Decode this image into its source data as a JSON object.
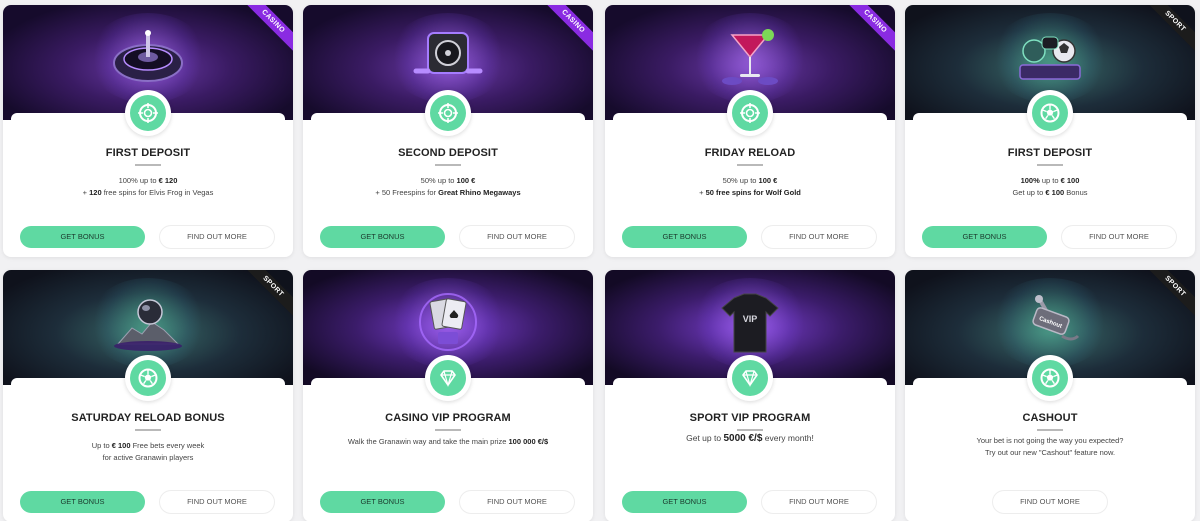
{
  "cards": [
    {
      "tag": "Casino",
      "title": "FIRST DEPOSIT",
      "line1_a": "100%",
      "line1_b": " up to ",
      "line1_c": "€ 120",
      "line2_a": "+ ",
      "line2_b": "120",
      "line2_c": " free spins for Elvis Frog in Vegas",
      "bonus_label": "GET BONUS",
      "more_label": "FIND OUT MORE",
      "icon": "roulette-chip-icon"
    },
    {
      "tag": "Casino",
      "title": "SECOND DEPOSIT",
      "line1_a": "50%",
      "line1_b": " up to ",
      "line1_c": "100 €",
      "line2_a": "+ 50 Freespins for ",
      "line2_b": "Great Rhino Megaways",
      "line2_c": "",
      "bonus_label": "GET BONUS",
      "more_label": "FIND OUT MORE",
      "icon": "roulette-chip-icon"
    },
    {
      "tag": "Casino",
      "title": "FRIDAY RELOAD",
      "line1_a": "50%",
      "line1_b": " up to ",
      "line1_c": "100 €",
      "line2_a": "+ ",
      "line2_b": "50 free spins for Wolf Gold",
      "line2_c": "",
      "bonus_label": "GET BONUS",
      "more_label": "FIND OUT MORE",
      "icon": "roulette-chip-icon"
    },
    {
      "tag": "Sport",
      "title": "FIRST DEPOSIT",
      "line1_a": "100%",
      "line1_b": " up to ",
      "line1_c": "€ 100",
      "line2_a": "Get up to ",
      "line2_b": "€ 100",
      "line2_c": " Bonus",
      "bonus_label": "GET BONUS",
      "more_label": "FIND OUT MORE",
      "icon": "soccer-ball-icon"
    },
    {
      "tag": "Sport",
      "title": "SATURDAY RELOAD BONUS",
      "line1_a": "Up to ",
      "line1_b": "€ 100",
      "line1_c": " Free bets every week",
      "line2_a": "for active Granawin players",
      "line2_b": "",
      "line2_c": "",
      "bonus_label": "GET BONUS",
      "more_label": "FIND OUT MORE",
      "icon": "soccer-ball-icon"
    },
    {
      "tag": "",
      "title": "CASINO VIP PROGRAM",
      "line1_a": "Walk the Granawin way and take the main prize ",
      "line1_b": "100 000 €/$",
      "line1_c": "",
      "line2_a": "",
      "line2_b": "",
      "line2_c": "",
      "bonus_label": "GET BONUS",
      "more_label": "FIND OUT MORE",
      "icon": "diamond-icon"
    },
    {
      "tag": "",
      "title": "SPORT VIP PROGRAM",
      "line1_a": "Get up to ",
      "line1_b": "5000 €/$",
      "line1_c": " every month!",
      "line2_a": "",
      "line2_b": "",
      "line2_c": "",
      "bonus_label": "GET BONUS",
      "more_label": "FIND OUT MORE",
      "icon": "diamond-icon"
    },
    {
      "tag": "Sport",
      "title": "CASHOUT",
      "line1_a": "Your bet is not going the way you expected?",
      "line1_b": "",
      "line1_c": "",
      "line2_a": "Try out our new \"Cashout\" feature now.",
      "line2_b": "",
      "line2_c": "",
      "bonus_label": "",
      "more_label": "FIND OUT MORE",
      "icon": "soccer-ball-icon"
    }
  ],
  "colors": {
    "accent": "#5fd9a2",
    "casino_ribbon": "#8a2be2",
    "sport_ribbon": "#1c1c1c",
    "background": "#f1f1f3"
  }
}
